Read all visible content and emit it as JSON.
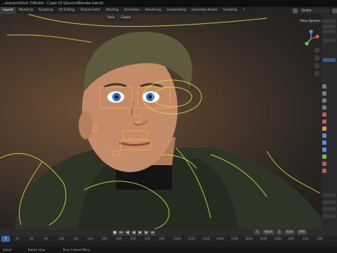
{
  "window": {
    "title": "...aracters\\Pack 2\\Model - Copie (D:\\Source\\Blender.blend)"
  },
  "workspace_tabs": [
    {
      "label": "Layout",
      "active": true
    },
    {
      "label": "Modeling",
      "active": false
    },
    {
      "label": "Sculpting",
      "active": false
    },
    {
      "label": "UV Editing",
      "active": false
    },
    {
      "label": "Texture Paint",
      "active": false
    },
    {
      "label": "Shading",
      "active": false
    },
    {
      "label": "Animation",
      "active": false
    },
    {
      "label": "Rendering",
      "active": false
    },
    {
      "label": "Compositing",
      "active": false
    },
    {
      "label": "Geometry Nodes",
      "active": false
    },
    {
      "label": "Scripting",
      "active": false
    },
    {
      "label": "+",
      "active": false
    }
  ],
  "scene": {
    "label": "Scene"
  },
  "viewport": {
    "mode_label": "Pose",
    "view_label": "Global",
    "pose_options": "Pose Options",
    "background": "#4d3a2c",
    "rig_color": "#d6e041",
    "face_control_color": "#f0a050"
  },
  "timeline": {
    "current_frame": "1",
    "start_label": "Start",
    "start_value": "1",
    "end_label": "End",
    "end_value": "250",
    "ruler_ticks": [
      "40",
      "60",
      "80",
      "100",
      "120",
      "140",
      "160",
      "180",
      "200",
      "220",
      "240",
      "1100",
      "1220",
      "1420",
      "1460",
      "1700",
      "1840",
      "1100",
      "2200",
      "240",
      "220",
      "300"
    ],
    "playhead_label": "1"
  },
  "status": {
    "left": "Select",
    "middle": "Rotate View",
    "right": "Pose Context Menu"
  },
  "colors": {
    "accent": "#3b69b2",
    "selected_row": "#2f5e9c"
  }
}
